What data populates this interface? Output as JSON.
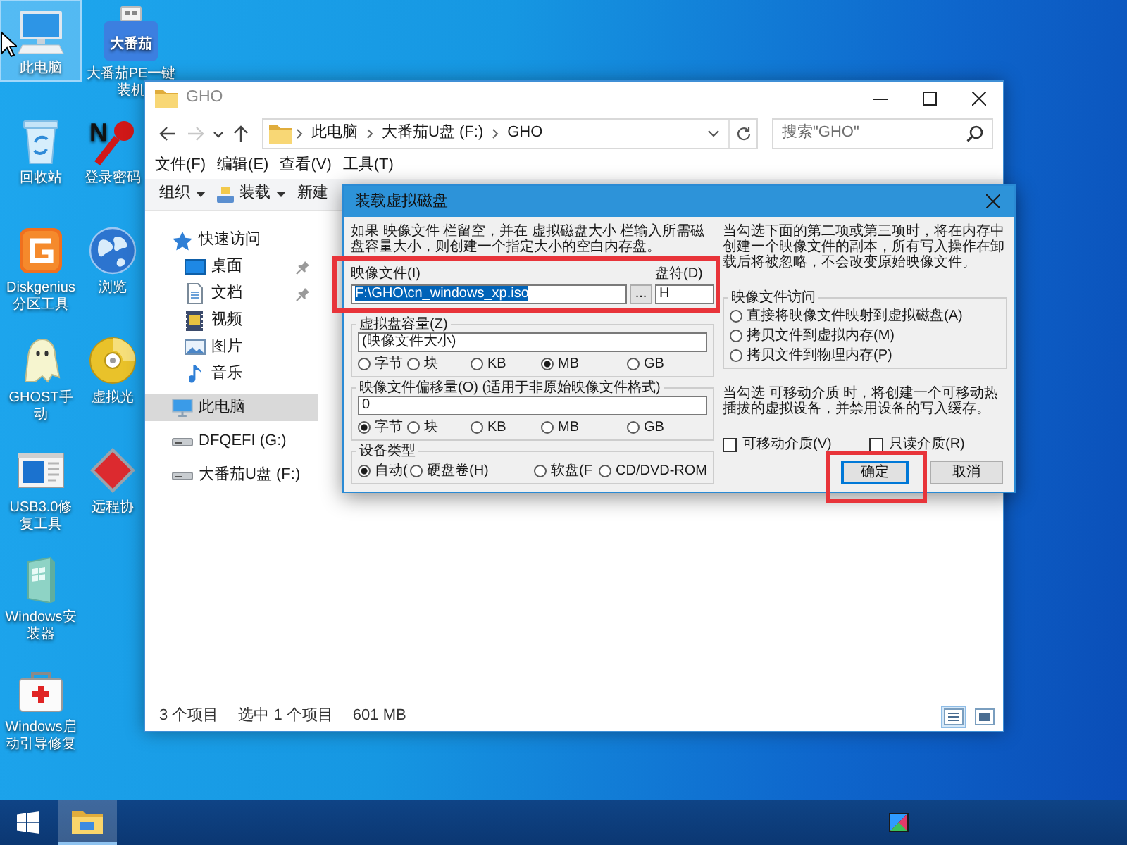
{
  "desktop": {
    "columns": [
      [
        {
          "label": "此电脑",
          "selected": true
        },
        {
          "label": "回收站",
          "selected": false
        },
        {
          "label": "Diskgenius分区工具",
          "selected": false
        },
        {
          "label": "GHOST手动",
          "selected": false
        },
        {
          "label": "USB3.0修复工具",
          "selected": false
        },
        {
          "label": "Windows安装器",
          "selected": false
        },
        {
          "label": "Windows启动引导修复",
          "selected": false
        }
      ],
      [
        {
          "label": "大番茄PE一键装机",
          "icon_text": "大番茄",
          "selected": false
        },
        {
          "label": "登录密码",
          "icon_text": "N",
          "selected": false
        },
        {
          "label": "浏览",
          "selected": false
        },
        {
          "label": "虚拟光",
          "selected": false
        },
        {
          "label": "远程协",
          "selected": false
        }
      ]
    ]
  },
  "explorer": {
    "title": "GHO",
    "nav_buttons": [
      {
        "kind": "back",
        "disabled": false
      },
      {
        "kind": "forward",
        "disabled": true
      },
      {
        "kind": "recent",
        "disabled": false
      },
      {
        "kind": "up",
        "disabled": false
      }
    ],
    "breadcrumbs": [
      "此电脑",
      "大番茄U盘 (F:)",
      "GHO"
    ],
    "search": {
      "placeholder": "搜索\"GHO\""
    },
    "menu": [
      "文件(F)",
      "编辑(E)",
      "查看(V)",
      "工具(T)"
    ],
    "toolbar": [
      {
        "label": "组织",
        "dropdown": true
      },
      {
        "label": "装载",
        "dropdown": true
      },
      {
        "label": "新建",
        "dropdown": false
      }
    ],
    "sidebar": [
      {
        "kind": "quick_access",
        "label": "快速访问",
        "selected": false,
        "children": [
          {
            "kind": "desktop",
            "label": "桌面",
            "selected": false,
            "pinned": true
          },
          {
            "kind": "documents",
            "label": "文档",
            "selected": false,
            "pinned": true
          },
          {
            "kind": "videos",
            "label": "视频",
            "selected": false,
            "pinned": false
          },
          {
            "kind": "pictures",
            "label": "图片",
            "selected": false,
            "pinned": false
          },
          {
            "kind": "music",
            "label": "音乐",
            "selected": false,
            "pinned": false
          }
        ]
      },
      {
        "kind": "this_pc",
        "label": "此电脑",
        "selected": true
      },
      {
        "kind": "drive",
        "label": "DFQEFI (G:)",
        "selected": false
      },
      {
        "kind": "drive",
        "label": "大番茄U盘 (F:)",
        "selected": false
      }
    ],
    "status": [
      "3 个项目",
      "选中 1 个项目",
      "601 MB"
    ],
    "view_buttons": [
      {
        "kind": "details",
        "selected": true
      },
      {
        "kind": "thumbnails",
        "selected": false
      }
    ]
  },
  "dialog": {
    "title": "装载虚拟磁盘",
    "intro": "如果 映像文件 栏留空，并在 虚拟磁盘大小 栏输入所需磁盘容量大小，则创建一个指定大小的空白内存盘。",
    "image_file": {
      "label": "映像文件(I)",
      "value": "F:\\GHO\\cn_windows_xp.iso",
      "value_selected": true,
      "browse": "...",
      "highlighted": true
    },
    "drive_letter": {
      "label": "盘符(D)",
      "value": "H"
    },
    "size": {
      "legend": "虚拟盘容量(Z)",
      "value": "(映像文件大小)",
      "units": [
        {
          "label": "字节",
          "selected": false
        },
        {
          "label": "块",
          "selected": false
        },
        {
          "label": "KB",
          "selected": false
        },
        {
          "label": "MB",
          "selected": true
        },
        {
          "label": "GB",
          "selected": false
        }
      ]
    },
    "offset": {
      "legend": "映像文件偏移量(O) (适用于非原始映像文件格式)",
      "value": "0",
      "units": [
        {
          "label": "字节",
          "selected": true
        },
        {
          "label": "块",
          "selected": false
        },
        {
          "label": "KB",
          "selected": false
        },
        {
          "label": "MB",
          "selected": false
        },
        {
          "label": "GB",
          "selected": false
        }
      ]
    },
    "device_type": {
      "legend": "设备类型",
      "options": [
        {
          "label": "自动(",
          "selected": true
        },
        {
          "label": "硬盘卷(H)",
          "selected": false
        },
        {
          "label": "软盘(F",
          "selected": false
        },
        {
          "label": "CD/DVD-ROM",
          "selected": false
        }
      ]
    },
    "access_note": "当勾选下面的第二项或第三项时，将在内存中创建一个映像文件的副本，所有写入操作在卸载后将被忽略，不会改变原始映像文件。",
    "access": {
      "legend": "映像文件访问",
      "options": [
        {
          "label": "直接将映像文件映射到虚拟磁盘(A)",
          "selected": false
        },
        {
          "label": "拷贝文件到虚拟内存(M)",
          "selected": false
        },
        {
          "label": "拷贝文件到物理内存(P)",
          "selected": false
        }
      ]
    },
    "removable_note": "当勾选 可移动介质 时，将创建一个可移动热插拔的虚拟设备，并禁用设备的写入缓存。",
    "checkboxes": [
      {
        "label": "可移动介质(V)",
        "checked": false
      },
      {
        "label": "只读介质(R)",
        "checked": false
      }
    ],
    "buttons": [
      {
        "label": "确定",
        "default": true,
        "highlighted": true
      },
      {
        "label": "取消",
        "default": false,
        "highlighted": false
      }
    ]
  },
  "taskbar": {
    "apps": [
      {
        "active": true
      }
    ]
  }
}
